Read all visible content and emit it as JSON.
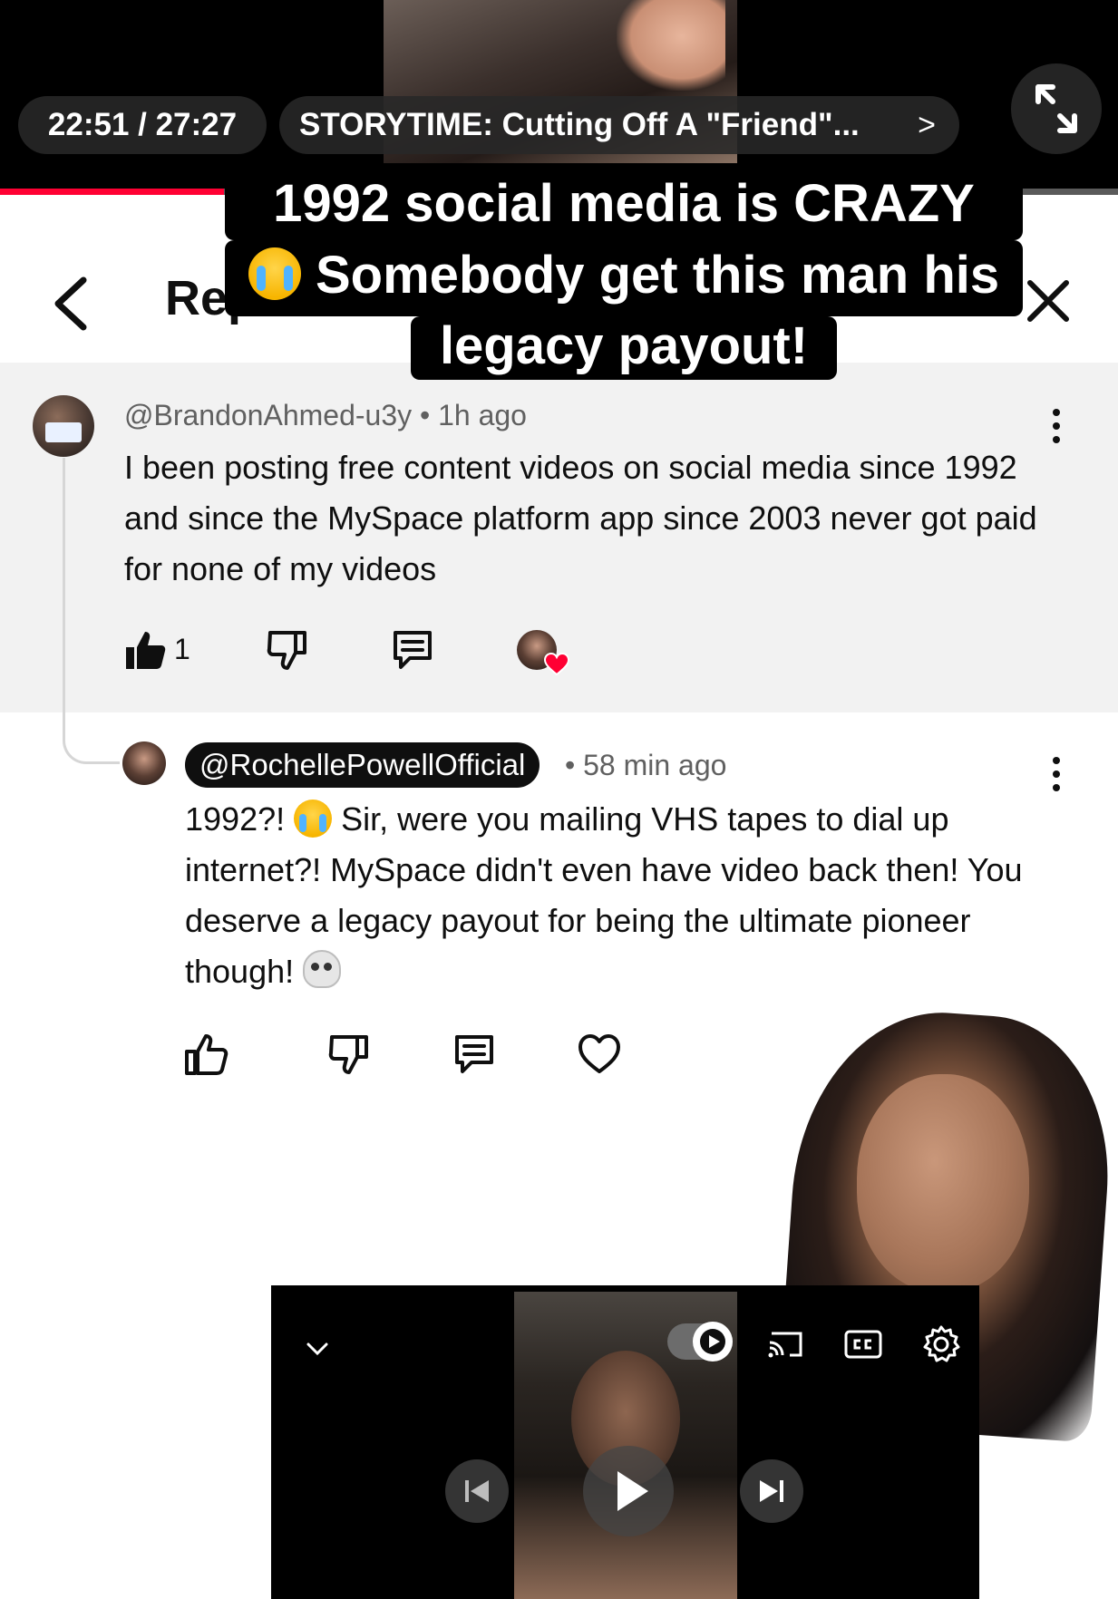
{
  "video": {
    "time": "22:51 / 27:27",
    "title": "STORYTIME: Cutting Off A \"Friend\"...",
    "title_chevron": ">",
    "progress_fraction": 0.2
  },
  "sheet": {
    "title": "Replies"
  },
  "caption": {
    "line1": "1992 social media is CRAZY",
    "line2": "Somebody get this man his",
    "line3": "legacy payout!"
  },
  "parent_comment": {
    "author": "@BrandonAhmed-u3y",
    "separator": "•",
    "time": "1h ago",
    "text": "I been posting free content videos on social media since 1992 and since the  MySpace platform app since 2003 never got paid for none of my videos",
    "like_count": "1",
    "creator_hearted": true
  },
  "reply_comment": {
    "author": "@RochellePowellOfficial",
    "separator": "•",
    "time": "58 min ago",
    "text_before_emoji": "1992?! ",
    "text_after_emoji": " Sir, were you mailing VHS tapes to dial up internet?! MySpace didn't even have video back then! You deserve a legacy payout for being the ultimate pioneer though! "
  },
  "colors": {
    "accent_red": "#ff0033",
    "highlight_bg": "#f2f2f2",
    "meta_gray": "#606060"
  },
  "icons": {
    "like": "thumbs-up-icon",
    "dislike": "thumbs-down-icon",
    "reply": "comment-icon",
    "heart": "heart-icon",
    "more": "more-vert-icon",
    "back": "chevron-left-icon",
    "close": "close-icon",
    "expand": "expand-icon",
    "cast": "cast-icon",
    "cc": "closed-captions-icon",
    "settings": "gear-icon"
  }
}
